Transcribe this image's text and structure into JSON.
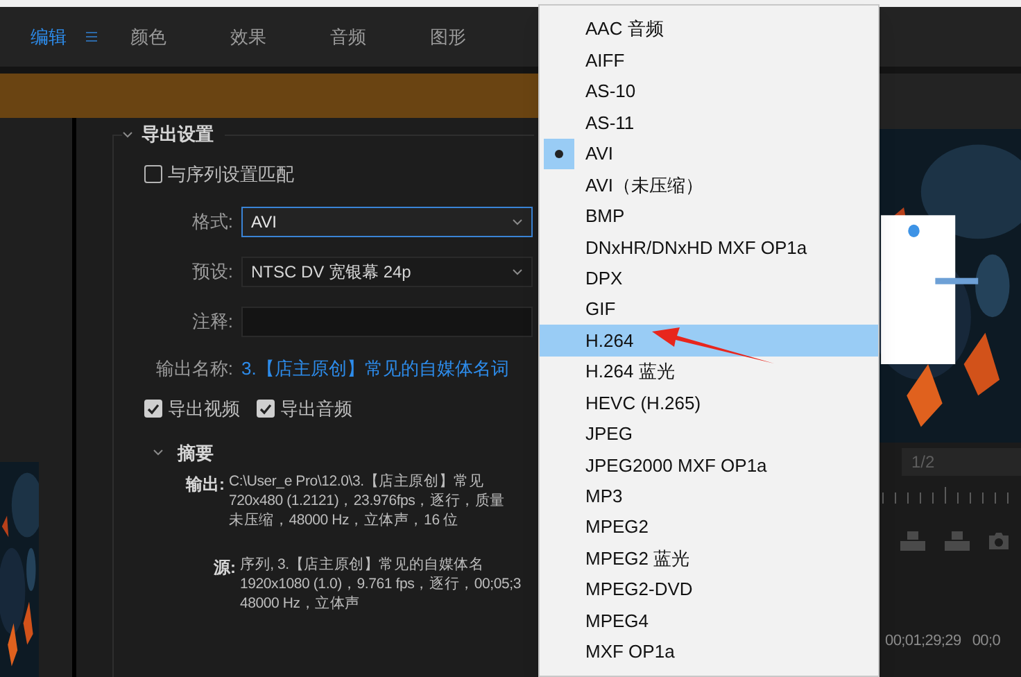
{
  "workspace_tabs": [
    {
      "label": "编辑",
      "selected": true
    },
    {
      "label": "颜色",
      "selected": false
    },
    {
      "label": "效果",
      "selected": false
    },
    {
      "label": "音频",
      "selected": false
    },
    {
      "label": "图形",
      "selected": false
    }
  ],
  "export_settings": {
    "title": "导出设置",
    "expanded": true,
    "match_sequence": {
      "label": "与序列设置匹配",
      "checked": false
    },
    "format": {
      "label": "格式:",
      "value": "AVI"
    },
    "preset": {
      "label": "预设:",
      "value": "NTSC DV 宽银幕 24p"
    },
    "comment": {
      "label": "注释:"
    },
    "output_name": {
      "label": "输出名称:",
      "value": "3.【店主原创】常见的自媒体名词"
    },
    "export_video": {
      "label": "导出视频",
      "checked": true
    },
    "export_audio": {
      "label": "导出音频",
      "checked": true
    },
    "summary": {
      "title": "摘要",
      "expanded": true,
      "output": {
        "label": "输出:",
        "lines": [
          "C:\\User_e Pro\\12.0\\3.【店主原创】常见",
          "720x480 (1.2121)，23.976fps，逐行，质量",
          "未压缩，48000 Hz，立体声，16 位"
        ]
      },
      "source": {
        "label": "源:",
        "lines": [
          "序列, 3.【店主原创】常见的自媒体名",
          "1920x1080 (1.0)，9.761 fps，逐行，00;05;3",
          "48000 Hz，立体声"
        ]
      }
    }
  },
  "format_menu": [
    {
      "label": "AAC 音频",
      "checked": false,
      "highlighted": false
    },
    {
      "label": "AIFF",
      "checked": false,
      "highlighted": false
    },
    {
      "label": "AS-10",
      "checked": false,
      "highlighted": false
    },
    {
      "label": "AS-11",
      "checked": false,
      "highlighted": false
    },
    {
      "label": "AVI",
      "checked": true,
      "highlighted": false
    },
    {
      "label": "AVI（未压缩）",
      "checked": false,
      "highlighted": false
    },
    {
      "label": "BMP",
      "checked": false,
      "highlighted": false
    },
    {
      "label": "DNxHR/DNxHD MXF OP1a",
      "checked": false,
      "highlighted": false
    },
    {
      "label": "DPX",
      "checked": false,
      "highlighted": false
    },
    {
      "label": "GIF",
      "checked": false,
      "highlighted": false
    },
    {
      "label": "H.264",
      "checked": false,
      "highlighted": true
    },
    {
      "label": "H.264 蓝光",
      "checked": false,
      "highlighted": false
    },
    {
      "label": "HEVC (H.265)",
      "checked": false,
      "highlighted": false
    },
    {
      "label": "JPEG",
      "checked": false,
      "highlighted": false
    },
    {
      "label": "JPEG2000 MXF OP1a",
      "checked": false,
      "highlighted": false
    },
    {
      "label": "MP3",
      "checked": false,
      "highlighted": false
    },
    {
      "label": "MPEG2",
      "checked": false,
      "highlighted": false
    },
    {
      "label": "MPEG2 蓝光",
      "checked": false,
      "highlighted": false
    },
    {
      "label": "MPEG2-DVD",
      "checked": false,
      "highlighted": false
    },
    {
      "label": "MPEG4",
      "checked": false,
      "highlighted": false
    },
    {
      "label": "MXF OP1a",
      "checked": false,
      "highlighted": false
    }
  ],
  "preview": {
    "kind": "picture",
    "page_select": "1/2",
    "timecodes": [
      "00;01;29;29",
      "00;0"
    ]
  }
}
